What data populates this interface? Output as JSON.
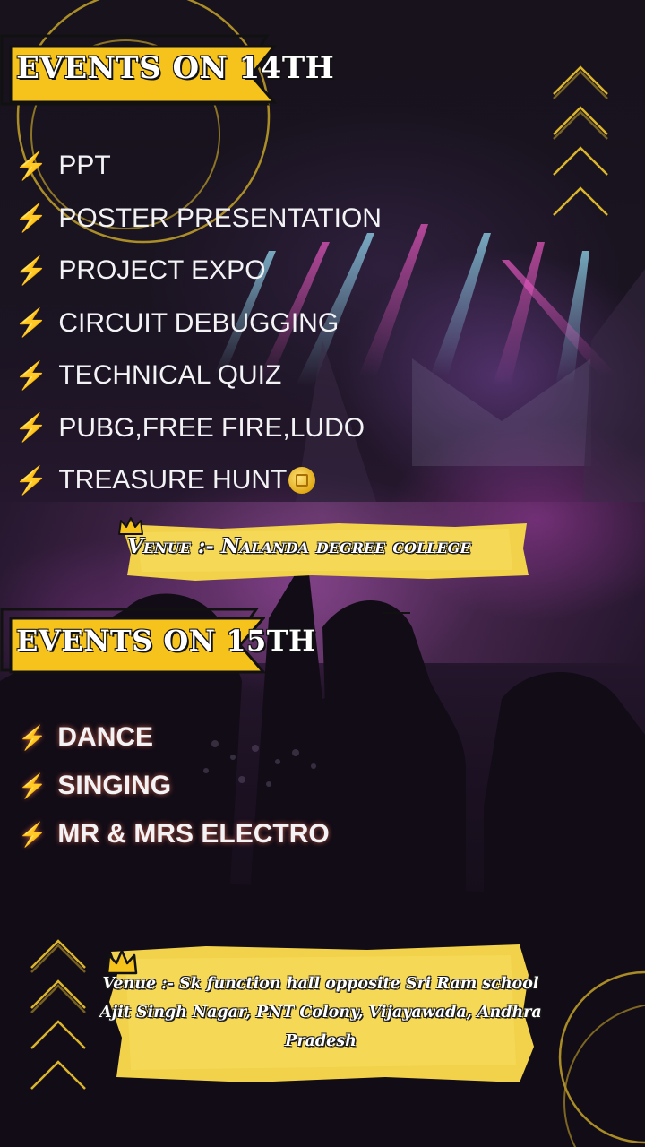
{
  "day1": {
    "banner": "EVENTS ON 14TH",
    "events": [
      "PPT",
      "POSTER PRESENTATION",
      "PROJECT EXPO",
      "CIRCUIT DEBUGGING",
      "TECHNICAL QUIZ",
      "PUBG,FREE FIRE,LUDO",
      "TREASURE HUNT"
    ],
    "venue": "Venue :- Nalanda degree college"
  },
  "day2": {
    "banner": "EVENTS ON 15TH",
    "events": [
      "DANCE",
      "SINGING",
      "MR & MRS ELECTRO"
    ],
    "venue_lines": [
      "Venue :- Sk function hall opposite Sri Ram school",
      "Ajit Singh Nagar, PNT Colony, Vijayawada, Andhra",
      "Pradesh"
    ]
  },
  "bullet_icon": "lightning-bolt",
  "colors": {
    "accent": "#f6c21c",
    "text": "#f3f3f6",
    "background": "#17121c",
    "highlight": "#f2d24a"
  }
}
